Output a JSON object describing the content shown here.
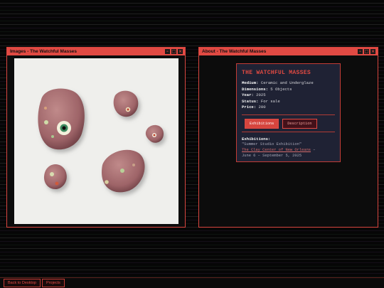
{
  "images_window": {
    "title": "Images - The Watchful Masses",
    "controls": [
      "–",
      "□",
      "×"
    ]
  },
  "about_window": {
    "title": "About - The Watchful Masses",
    "controls": [
      "–",
      "□",
      "×"
    ],
    "card": {
      "title": "THE WATCHFUL MASSES",
      "fields": [
        {
          "label": "Medium:",
          "value": "Ceramic and Underglaze"
        },
        {
          "label": "Dimensions:",
          "value": "5 Objects"
        },
        {
          "label": "Year:",
          "value": "2025"
        },
        {
          "label": "Status:",
          "value": "For sale"
        },
        {
          "label": "Price:",
          "value": "200"
        }
      ],
      "tabs": {
        "exhibitions": "Exhibitions",
        "description": "Description"
      },
      "exhibitions_heading": "Exhibitions:",
      "exhibition_name": "\"Summer Studio Exhibition\"",
      "exhibition_venue": "The Clay Center of New Orleans",
      "exhibition_sep": " –",
      "exhibition_dates": "June 6 – September 5, 2025"
    }
  },
  "taskbar": {
    "back": "Back to Desktop",
    "projects": "Projects"
  },
  "colors": {
    "accent": "#e14a43",
    "card_bg": "#1f2234",
    "desktop": "#060606"
  }
}
